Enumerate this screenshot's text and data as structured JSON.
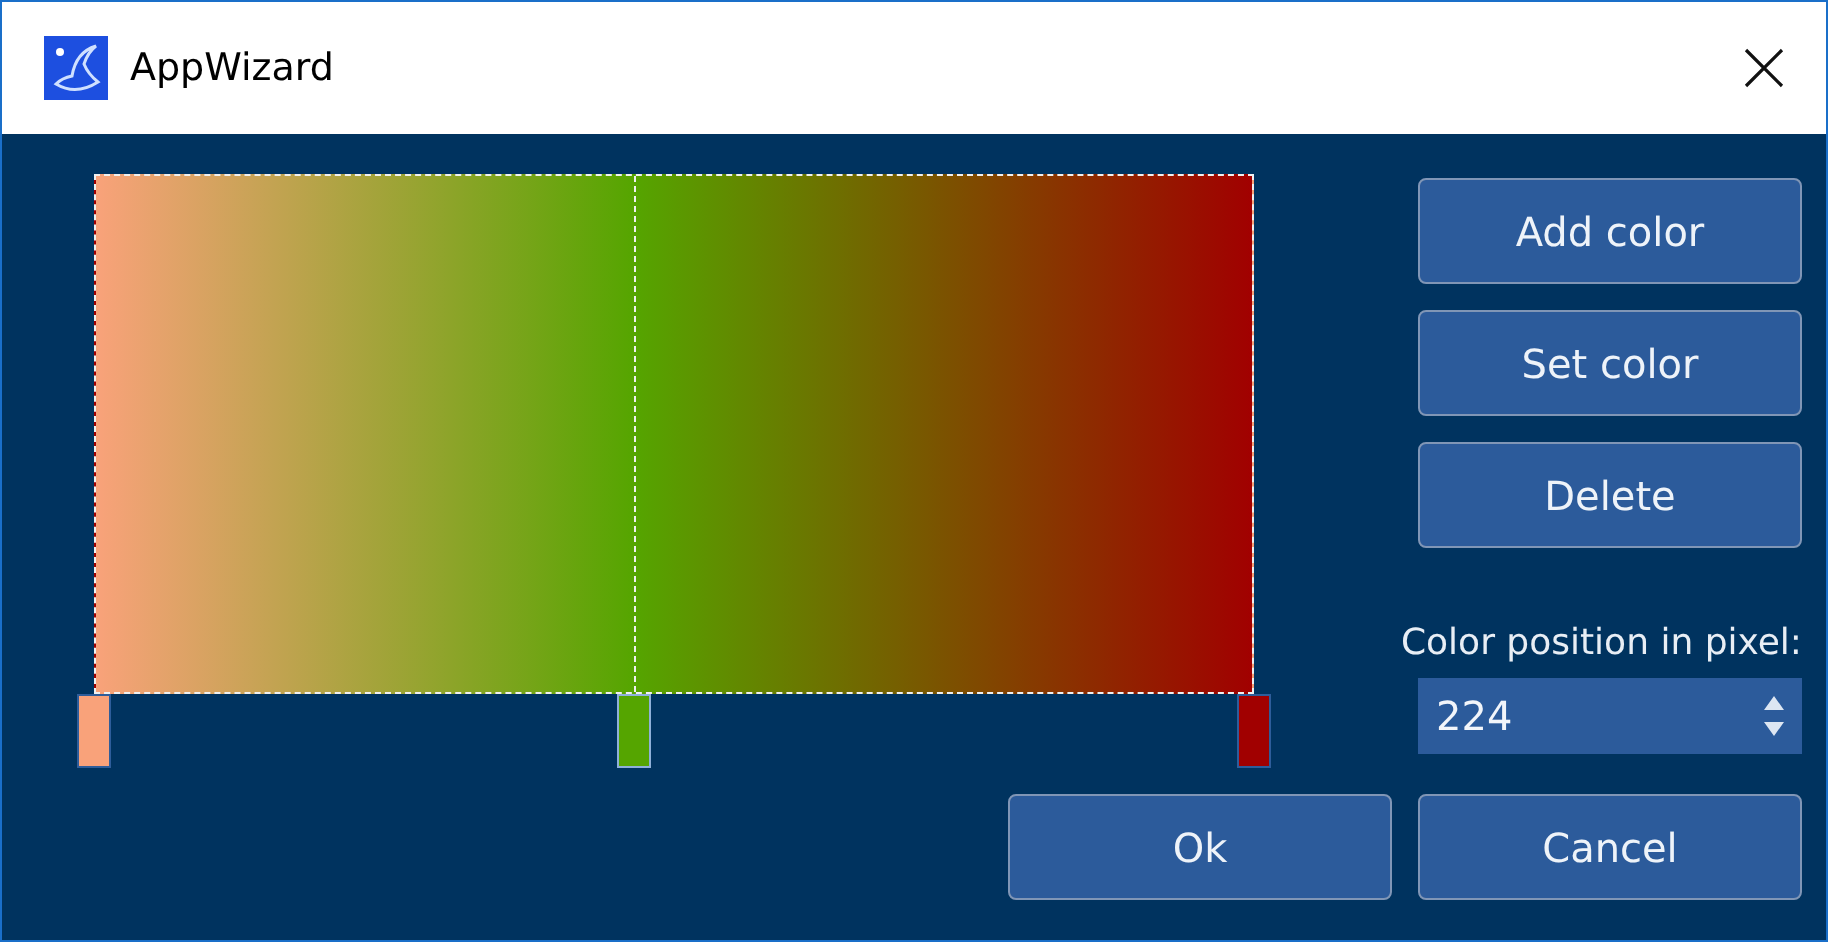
{
  "window": {
    "title": "AppWizard"
  },
  "gradient": {
    "stops": [
      {
        "level": 0,
        "color": "#f9a27a",
        "selected": false
      },
      {
        "level": 0.466,
        "color": "#55a500",
        "selected": true
      },
      {
        "level": 1,
        "color": "#a10000",
        "selected": false
      }
    ]
  },
  "buttons": [
    "Add color",
    "Set color",
    "Delete"
  ],
  "position": {
    "label": "Color position in pixel:",
    "value": "224"
  },
  "actions": [
    "Ok",
    "Cancel"
  ]
}
